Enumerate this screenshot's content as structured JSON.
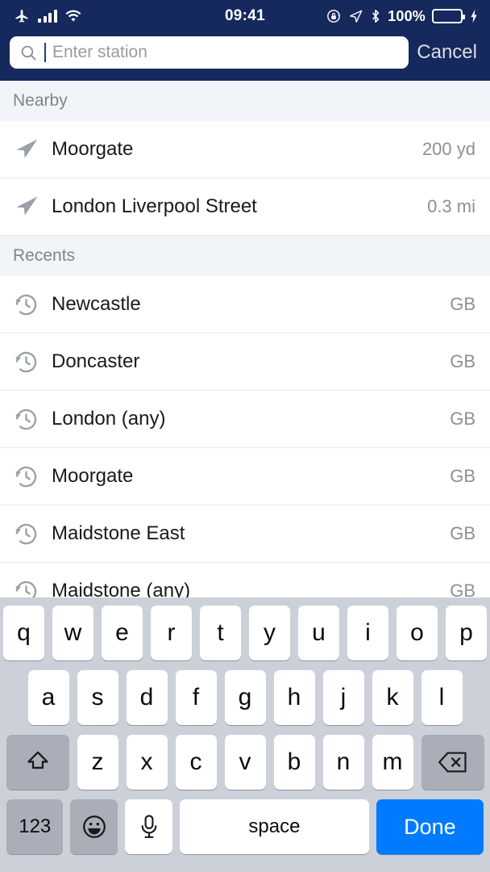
{
  "status_bar": {
    "airplane_icon": "airplane-icon",
    "signal_icon": "cellular-bars-icon",
    "wifi_icon": "wifi-icon",
    "time": "09:41",
    "rotation_lock_icon": "rotation-lock-icon",
    "location_icon": "location-arrow-icon",
    "bluetooth_icon": "bluetooth-icon",
    "battery_percent": "100%",
    "battery_icon": "battery-full-icon",
    "charging_icon": "lightning-bolt-icon",
    "battery_color": "#4cd964",
    "bar_color": "#16295c"
  },
  "search": {
    "icon": "search-icon",
    "placeholder": "Enter station",
    "value": "",
    "cancel_label": "Cancel"
  },
  "sections": [
    {
      "header": "Nearby",
      "icon": "navigation-arrow-icon",
      "rows": [
        {
          "label": "Moorgate",
          "meta": "200 yd"
        },
        {
          "label": "London Liverpool Street",
          "meta": "0.3 mi"
        }
      ]
    },
    {
      "header": "Recents",
      "icon": "clock-history-icon",
      "rows": [
        {
          "label": "Newcastle",
          "meta": "GB"
        },
        {
          "label": "Doncaster",
          "meta": "GB"
        },
        {
          "label": "London (any)",
          "meta": "GB"
        },
        {
          "label": "Moorgate",
          "meta": "GB"
        },
        {
          "label": "Maidstone East",
          "meta": "GB"
        },
        {
          "label": "Maidstone (any)",
          "meta": "GB"
        }
      ]
    }
  ],
  "keyboard": {
    "row1": [
      "q",
      "w",
      "e",
      "r",
      "t",
      "y",
      "u",
      "i",
      "o",
      "p"
    ],
    "row2": [
      "a",
      "s",
      "d",
      "f",
      "g",
      "h",
      "j",
      "k",
      "l"
    ],
    "row3": [
      "z",
      "x",
      "c",
      "v",
      "b",
      "n",
      "m"
    ],
    "shift_icon": "shift-arrow-icon",
    "backspace_icon": "backspace-icon",
    "numbers_label": "123",
    "emoji_icon": "emoji-smiley-icon",
    "mic_icon": "microphone-icon",
    "space_label": "space",
    "done_label": "Done",
    "done_color": "#007aff"
  }
}
